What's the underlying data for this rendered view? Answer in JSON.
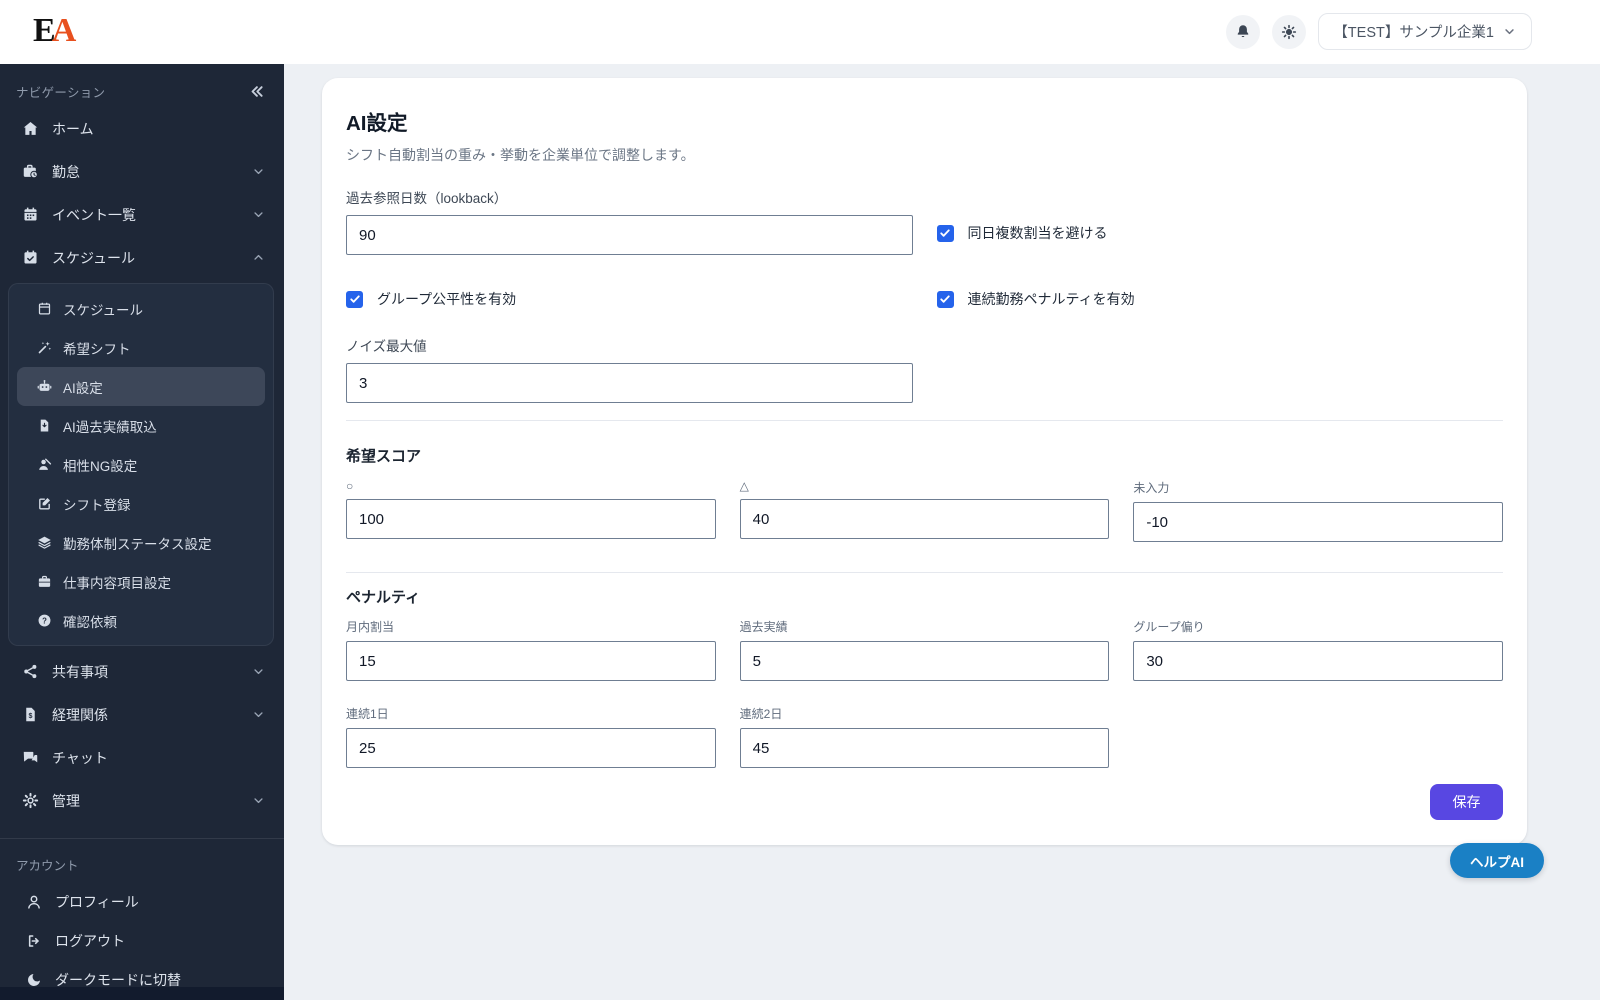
{
  "header": {
    "logo_e": "E",
    "logo_a": "A",
    "company_selector_label": "【TEST】サンプル企業1"
  },
  "sidebar": {
    "section_title": "ナビゲーション",
    "items": [
      {
        "label": "ホーム"
      },
      {
        "label": "勤怠"
      },
      {
        "label": "イベント一覧"
      },
      {
        "label": "スケジュール"
      }
    ],
    "submenu": [
      {
        "label": "スケジュール"
      },
      {
        "label": "希望シフト"
      },
      {
        "label": "AI設定",
        "active": true
      },
      {
        "label": "AI過去実績取込"
      },
      {
        "label": "相性NG設定"
      },
      {
        "label": "シフト登録"
      },
      {
        "label": "勤務体制ステータス設定"
      },
      {
        "label": "仕事内容項目設定"
      },
      {
        "label": "確認依頼"
      }
    ],
    "items_lower": [
      {
        "label": "共有事項"
      },
      {
        "label": "経理関係"
      },
      {
        "label": "チャット"
      },
      {
        "label": "管理"
      }
    ],
    "account_section_title": "アカウント",
    "account_items": [
      {
        "label": "プロフィール"
      },
      {
        "label": "ログアウト"
      },
      {
        "label": "ダークモードに切替"
      }
    ]
  },
  "main": {
    "title": "AI設定",
    "subtitle": "シフト自動割当の重み・挙動を企業単位で調整します。",
    "lookback": {
      "label": "過去参照日数（lookback）",
      "value": "90"
    },
    "noise": {
      "label": "ノイズ最大値",
      "value": "3"
    },
    "checkbox_same_day": {
      "label": "同日複数割当を避ける",
      "checked": true
    },
    "checkbox_group_fair": {
      "label": "グループ公平性を有効",
      "checked": true
    },
    "checkbox_consecutive": {
      "label": "連続勤務ペナルティを有効",
      "checked": true
    },
    "score_section": {
      "title": "希望スコア",
      "fields": [
        {
          "label": "○",
          "value": "100"
        },
        {
          "label": "△",
          "value": "40"
        },
        {
          "label": "未入力",
          "value": "-10"
        }
      ]
    },
    "penalty_section": {
      "title": "ペナルティ",
      "fields": [
        {
          "label": "月内割当",
          "value": "15"
        },
        {
          "label": "過去実績",
          "value": "5"
        },
        {
          "label": "グループ偏り",
          "value": "30"
        },
        {
          "label": "連続1日",
          "value": "25"
        },
        {
          "label": "連続2日",
          "value": "45"
        }
      ]
    },
    "save_button_label": "保存"
  },
  "help_button_label": "ヘルプAI",
  "colors": {
    "sidebar_bg": "#1e2737",
    "accent_checkbox": "#2563eb",
    "save_button": "#5847e2",
    "help_button": "#1a80c5",
    "logo_accent": "#e8501e"
  }
}
